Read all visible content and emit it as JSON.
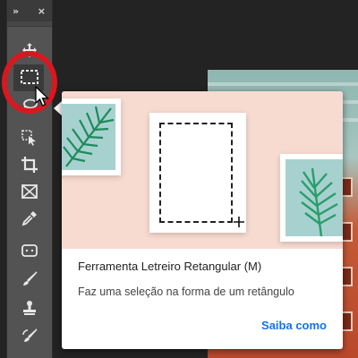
{
  "toolbar": {
    "header_collapse": "»",
    "header_close": "×",
    "tools": [
      {
        "id": "move",
        "icon": "move-tool-icon"
      },
      {
        "id": "marquee",
        "icon": "rectangular-marquee-icon",
        "active": true
      },
      {
        "id": "lasso",
        "icon": "lasso-icon"
      },
      {
        "id": "object-select",
        "icon": "object-selection-icon"
      },
      {
        "id": "crop",
        "icon": "crop-icon"
      },
      {
        "id": "frame",
        "icon": "frame-tool-icon"
      },
      {
        "id": "eyedropper",
        "icon": "eyedropper-icon"
      },
      {
        "id": "patch",
        "icon": "spot-healing-icon"
      },
      {
        "id": "brush",
        "icon": "brush-icon"
      },
      {
        "id": "stamp",
        "icon": "clone-stamp-icon"
      },
      {
        "id": "history-brush",
        "icon": "history-brush-icon"
      }
    ]
  },
  "tooltip": {
    "title": "Ferramenta Letreiro Retangular (M)",
    "description": "Faz uma seleção na forma de um retângulo",
    "link": "Saiba como"
  },
  "colors": {
    "toolbar_bg": "#535353",
    "highlight_ring": "#d8181f",
    "link": "#1473e6",
    "illustration_bg": "#f7dbd1"
  }
}
